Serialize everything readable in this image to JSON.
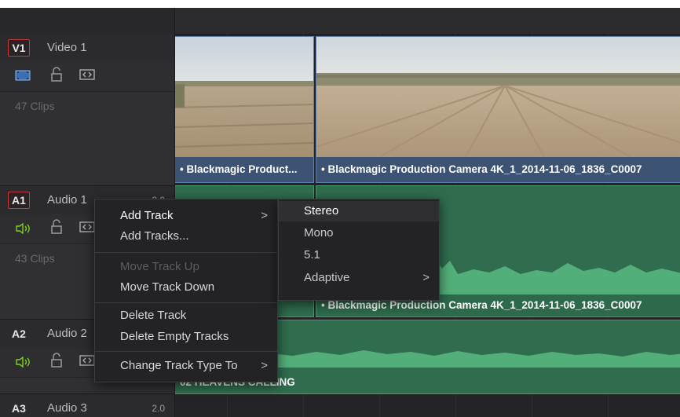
{
  "tracks": [
    {
      "tag": "V1",
      "name": "Video 1",
      "channels": "",
      "clip_count": "47 Clips"
    },
    {
      "tag": "A1",
      "name": "Audio 1",
      "channels": "2.0",
      "clip_count": "43 Clips"
    },
    {
      "tag": "A2",
      "name": "Audio 2",
      "channels": "",
      "clip_count": ""
    },
    {
      "tag": "A3",
      "name": "Audio 3",
      "channels": "2.0",
      "clip_count": ""
    }
  ],
  "timeline": {
    "video_clip_1_label": "• Blackmagic Product...",
    "video_clip_2_label": "• Blackmagic Production Camera 4K_1_2014-11-06_1836_C0007",
    "audio_clip_label": "• Blackmagic Production Camera 4K_1_2014-11-06_1836_C0007",
    "audio2_clip_label": "02 HEAVENS CALLING"
  },
  "context_menu": {
    "items": [
      {
        "label": "Add Track",
        "submenu": true
      },
      {
        "label": "Add Tracks..."
      },
      {
        "label": "Move Track Up",
        "disabled": true
      },
      {
        "label": "Move Track Down"
      },
      {
        "label": "Delete Track"
      },
      {
        "label": "Delete Empty Tracks"
      },
      {
        "label": "Change Track Type To",
        "submenu": true
      }
    ],
    "arrow": ">"
  },
  "submenu": {
    "items": [
      {
        "label": "Stereo"
      },
      {
        "label": "Mono"
      },
      {
        "label": "5.1"
      },
      {
        "label": "Adaptive"
      }
    ],
    "arrow": ">"
  },
  "colors": {
    "video_clip": "#3d5373",
    "audio_clip": "#2f6d4e",
    "track_selected_border": "#c9383a",
    "speaker_on": "#7ed321"
  }
}
